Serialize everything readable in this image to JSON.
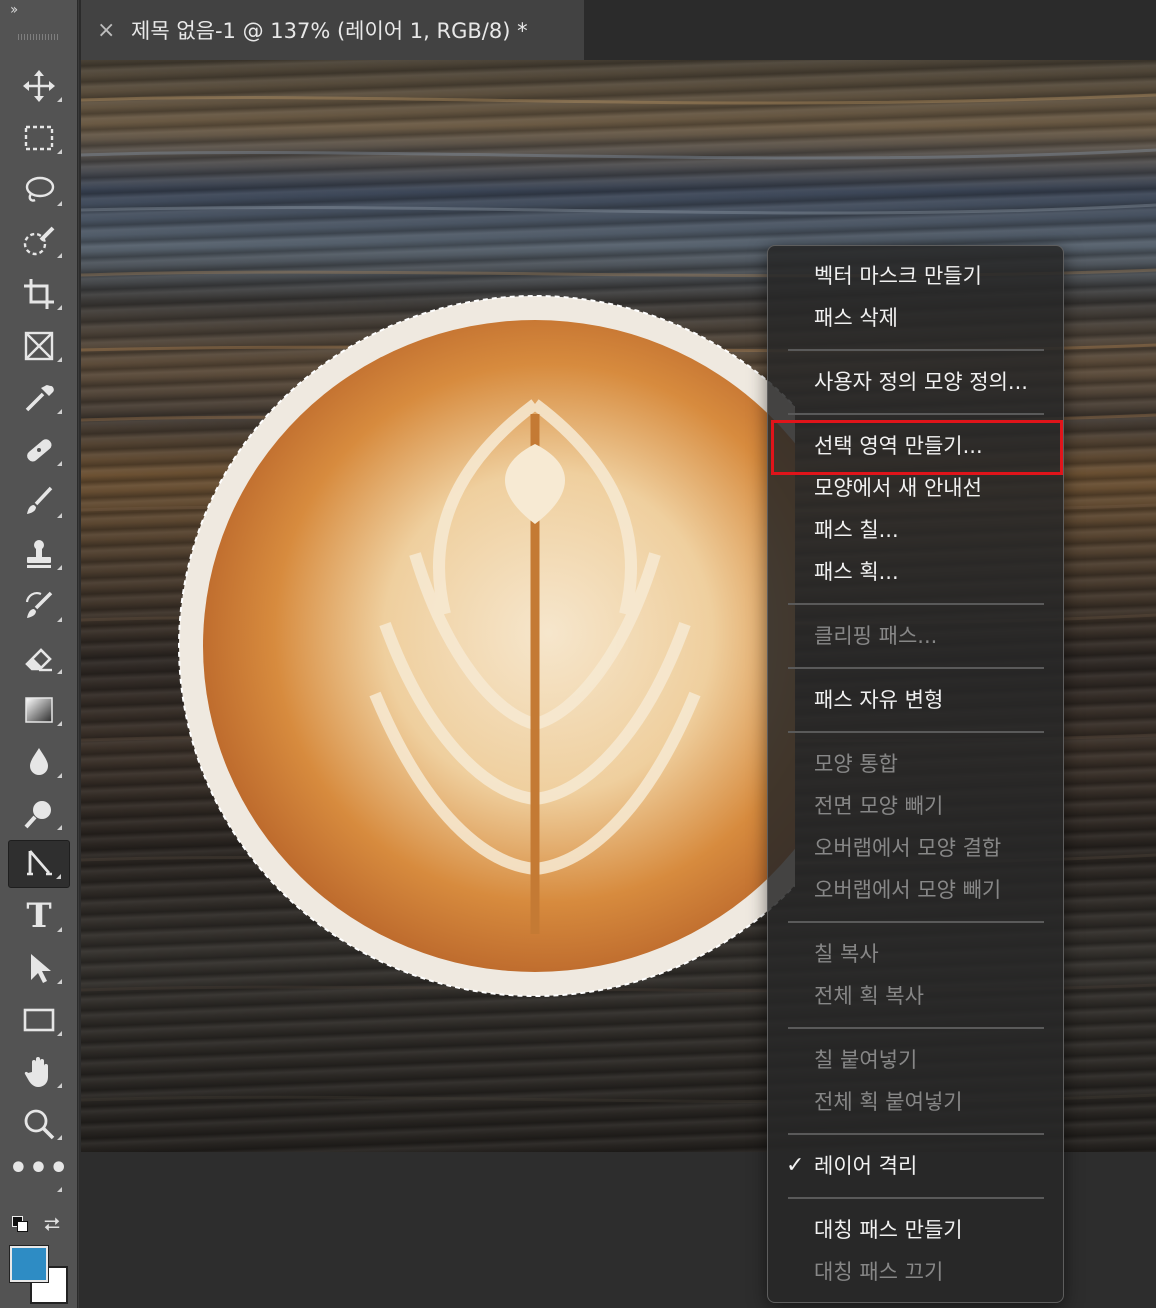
{
  "toolbar": {
    "collapse_label": "››",
    "tools": [
      {
        "name": "move-tool",
        "icon": "move-icon"
      },
      {
        "name": "marquee-tool",
        "icon": "rect-marquee-icon"
      },
      {
        "name": "lasso-tool",
        "icon": "lasso-icon"
      },
      {
        "name": "quick-selection-tool",
        "icon": "quick-selection-icon"
      },
      {
        "name": "crop-tool",
        "icon": "crop-icon"
      },
      {
        "name": "frame-tool",
        "icon": "frame-icon"
      },
      {
        "name": "eyedropper-tool",
        "icon": "eyedropper-icon"
      },
      {
        "name": "healing-brush-tool",
        "icon": "bandage-icon"
      },
      {
        "name": "brush-tool",
        "icon": "brush-icon"
      },
      {
        "name": "clone-stamp-tool",
        "icon": "stamp-icon"
      },
      {
        "name": "history-brush-tool",
        "icon": "history-brush-icon"
      },
      {
        "name": "eraser-tool",
        "icon": "eraser-icon"
      },
      {
        "name": "gradient-tool",
        "icon": "gradient-icon"
      },
      {
        "name": "blur-tool",
        "icon": "drop-icon"
      },
      {
        "name": "dodge-tool",
        "icon": "dodge-icon"
      },
      {
        "name": "pen-tool",
        "icon": "pen-icon",
        "active": true
      },
      {
        "name": "type-tool",
        "icon": "type-icon",
        "letter": "T"
      },
      {
        "name": "path-selection-tool",
        "icon": "arrow-icon"
      },
      {
        "name": "rectangle-tool",
        "icon": "rectangle-icon"
      },
      {
        "name": "hand-tool",
        "icon": "hand-icon"
      },
      {
        "name": "zoom-tool",
        "icon": "zoom-icon"
      },
      {
        "name": "more-tools",
        "icon": "ellipsis-icon",
        "dots": "•••"
      }
    ],
    "foreground_color": "#2e8cc4",
    "background_color": "#ffffff"
  },
  "document_tab": {
    "close_label": "×",
    "title": "제목 없음-1 @ 137% (레이어 1, RGB/8) *"
  },
  "context_menu": {
    "groups": [
      [
        {
          "label": "벡터 마스크 만들기",
          "enabled": true
        },
        {
          "label": "패스 삭제",
          "enabled": true
        }
      ],
      [
        {
          "label": "사용자 정의 모양 정의...",
          "enabled": true
        }
      ],
      [
        {
          "label": "선택 영역 만들기...",
          "enabled": true,
          "highlighted": true
        },
        {
          "label": "모양에서 새 안내선",
          "enabled": true
        },
        {
          "label": "패스 칠...",
          "enabled": true
        },
        {
          "label": "패스 획...",
          "enabled": true
        }
      ],
      [
        {
          "label": "클리핑 패스...",
          "enabled": false
        }
      ],
      [
        {
          "label": "패스 자유 변형",
          "enabled": true
        }
      ],
      [
        {
          "label": "모양 통합",
          "enabled": false
        },
        {
          "label": "전면 모양 빼기",
          "enabled": false
        },
        {
          "label": "오버랩에서 모양 결합",
          "enabled": false
        },
        {
          "label": "오버랩에서 모양 빼기",
          "enabled": false
        }
      ],
      [
        {
          "label": "칠 복사",
          "enabled": false
        },
        {
          "label": "전체 획 복사",
          "enabled": false
        }
      ],
      [
        {
          "label": "칠 붙여넣기",
          "enabled": false
        },
        {
          "label": "전체 획 붙여넣기",
          "enabled": false
        }
      ],
      [
        {
          "label": "레이어 격리",
          "enabled": true,
          "checked": true,
          "check_mark": "✓"
        }
      ],
      [
        {
          "label": "대칭 패스 만들기",
          "enabled": true
        },
        {
          "label": "대칭 패스 끄기",
          "enabled": false
        }
      ]
    ],
    "highlight_color": "#e0141a"
  }
}
